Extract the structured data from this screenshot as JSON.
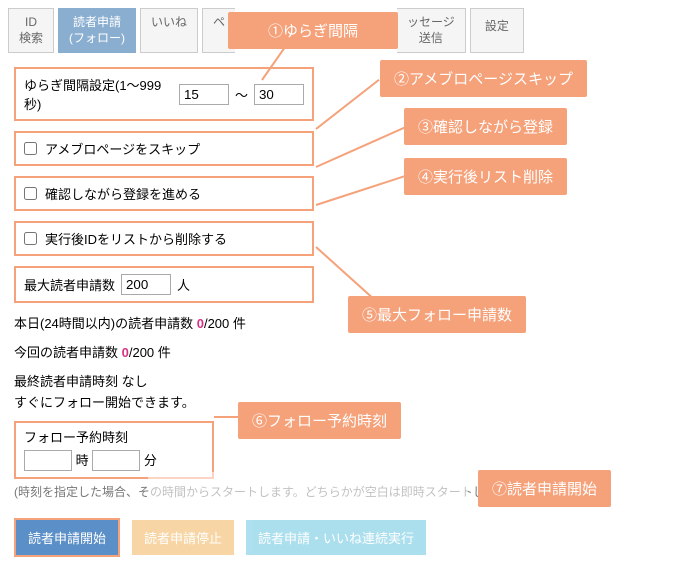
{
  "tabs": {
    "id_search": "ID\n検索",
    "reader_apply": "読者申請\n(フォロー)",
    "like": "いいね",
    "pe": "ペ",
    "msg": "ッセージ\n送信",
    "settings": "設定"
  },
  "interval": {
    "label": "ゆらぎ間隔設定(1～999秒)",
    "from": "15",
    "sep": "～",
    "to": "30"
  },
  "skip": {
    "label": "アメブロページをスキップ"
  },
  "confirm": {
    "label": "確認しながら登録を進める"
  },
  "delete_after": {
    "label": "実行後IDをリストから削除する"
  },
  "max": {
    "label": "最大読者申請数",
    "value": "200",
    "unit": "人"
  },
  "today": {
    "prefix": "本日(24時間以内)の読者申請数 ",
    "count": "0",
    "total": "/200 件"
  },
  "thisrun": {
    "prefix": "今回の読者申請数 ",
    "count": "0",
    "total": "/200 件"
  },
  "last": {
    "line1": "最終読者申請時刻 なし",
    "line2": "すぐにフォロー開始できます。"
  },
  "schedule": {
    "title": "フォロー予約時刻",
    "hour_unit": "時",
    "min_unit": "分"
  },
  "note": "(時刻を指定した場合、その時間からスタートします。どちらかが空白は即時スタートします)",
  "buttons": {
    "start": "読者申請開始",
    "stop": "読者申請停止",
    "combo": "読者申請・いいね連続実行"
  },
  "callouts": {
    "c1": "①ゆらぎ間隔",
    "c2": "②アメブロページスキップ",
    "c3": "③確認しながら登録",
    "c4": "④実行後リスト削除",
    "c5": "⑤最大フォロー申請数",
    "c6": "⑥フォロー予約時刻",
    "c7": "⑦読者申請開始"
  }
}
